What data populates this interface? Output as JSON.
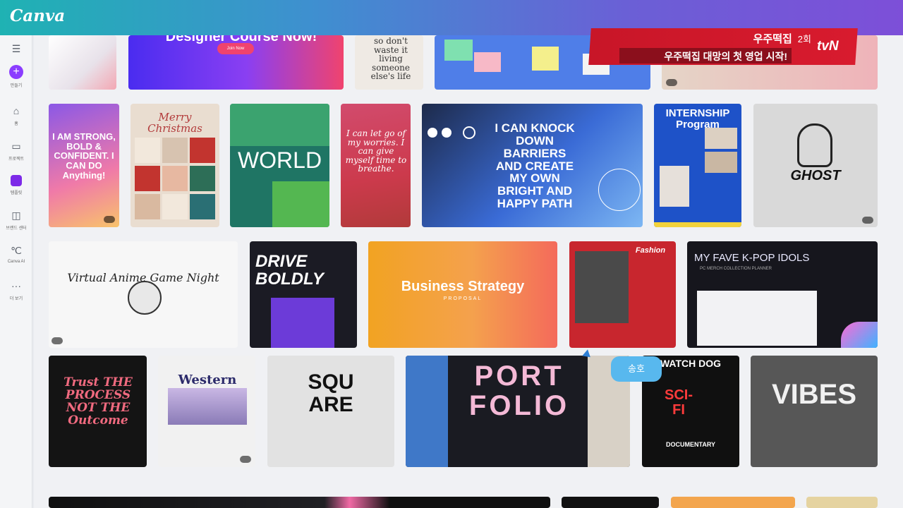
{
  "app": {
    "logo": "Canva"
  },
  "sidebar": {
    "items": [
      {
        "label": "만들기",
        "icon": "plus-icon"
      },
      {
        "label": "홈",
        "icon": "home-icon"
      },
      {
        "label": "프로젝트",
        "icon": "folder-icon"
      },
      {
        "label": "템플릿",
        "icon": "templates-icon"
      },
      {
        "label": "브랜드 센터",
        "icon": "brand-icon"
      },
      {
        "label": "Canva AI",
        "icon": "canva-ai-icon"
      },
      {
        "label": "더 보기",
        "icon": "more-icon"
      }
    ]
  },
  "broadcast": {
    "title": "우주떡집",
    "episode": "2회",
    "subtitle": "우주떡집 대망의 첫 영업 시작!",
    "channel": "tvN"
  },
  "tooltip": {
    "label": "송호"
  },
  "templates": {
    "row0": [
      "Designer Course Now!",
      "Join Now",
      "so don't waste it living someone else's life"
    ],
    "row1": [
      "I AM STRONG, BOLD & CONFIDENT. I CAN DO Anything!",
      "Merry Christmas",
      "WORLD",
      "I can let go of my worries. I can give myself time to breathe.",
      "I CAN KNOCK DOWN BARRIERS AND CREATE MY OWN BRIGHT AND HAPPY PATH",
      "INTERNSHIP Program",
      "GHOST"
    ],
    "row2": [
      "Virtual Anime Game Night",
      "DRIVE BOLDLY",
      "Business Strategy",
      "PROPOSAL",
      "Fashion",
      "MY FAVE K-POP IDOLS",
      "PC MERCH COLLECTION PLANNER"
    ],
    "row3": [
      "Trust THE PROCESS NOT THE Outcome",
      "Western",
      "SQU ARE",
      "PORT FOLIO",
      "WATCH DOG",
      "SCI-FI",
      "DOCUMENTARY",
      "VIBES"
    ]
  }
}
